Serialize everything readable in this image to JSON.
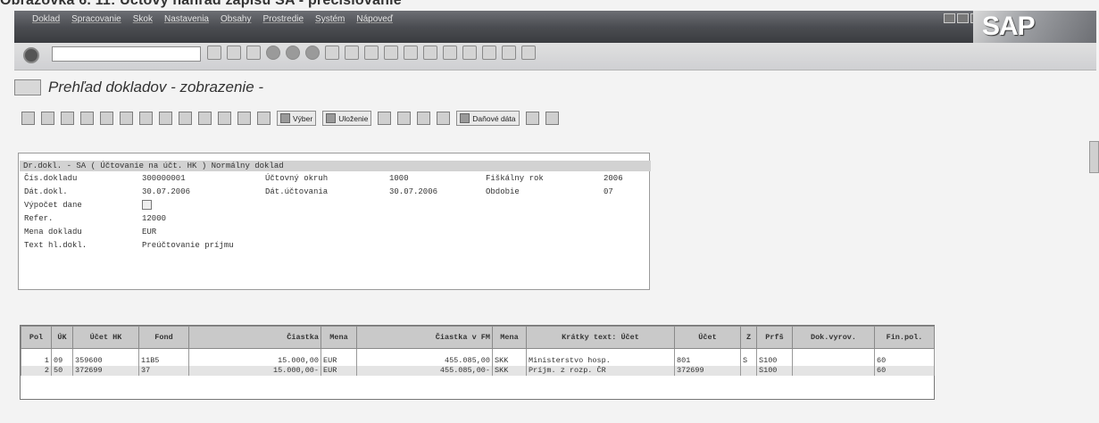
{
  "caption": "Obrazovka 6. 11: Účtový náhľad zápisu SA - prečíslovanie",
  "menu": [
    "Doklad",
    "Spracovanie",
    "Skok",
    "Nastavenia",
    "Obsahy",
    "Prostredie",
    "Systém",
    "Nápoveď"
  ],
  "logo": "SAP",
  "page_title": "Prehľad dokladov - zobrazenie -",
  "toolbar_buttons": {
    "vyber": "Výber",
    "ulozenie": "Uloženie",
    "danove": "Daňové dáta"
  },
  "header": {
    "title": "Dr.dokl. - SA ( Účtovanie na účt. HK ) Normálny doklad",
    "cis_dokladu_label": "Čís.dokladu",
    "cis_dokladu": "300000001",
    "uctovny_okruh_label": "Účtovný okruh",
    "uctovny_okruh": "1000",
    "fiskalny_rok_label": "Fiškálny rok",
    "fiskalny_rok": "2006",
    "dat_dokl_label": "Dát.dokl.",
    "dat_dokl": "30.07.2006",
    "dat_uctovania_label": "Dát.účtovania",
    "dat_uctovania": "30.07.2006",
    "obdobie_label": "Obdobie",
    "obdobie": "07",
    "vypocet_dane_label": "Výpočet dane",
    "refer_label": "Refer.",
    "refer": "12000",
    "mena_dokladu_label": "Mena dokladu",
    "mena_dokladu": "EUR",
    "text_label": "Text hl.dokl.",
    "text": "Preúčtovanie príjmu"
  },
  "grid": {
    "columns": [
      "Pol",
      "ÚK",
      "Účet HK",
      "Fond",
      "Čiastka",
      "Mena",
      "Čiastka v FM",
      "Mena",
      "Krátky text: Účet",
      "Účet",
      "Z",
      "Prfš",
      "Dok.vyrov.",
      "Fin.pol."
    ],
    "rows": [
      [
        "1",
        "09",
        "359600",
        "11B5",
        "15.000,00",
        "EUR",
        "455.085,00",
        "SKK",
        "Ministerstvo hosp.",
        "801",
        "S",
        "S100",
        "",
        "60"
      ],
      [
        "2",
        "50",
        "372699",
        "37",
        "15.000,00-",
        "EUR",
        "455.085,00-",
        "SKK",
        "Príjm. z rozp. ČR",
        "372699",
        "",
        "S100",
        "",
        "60"
      ]
    ]
  }
}
